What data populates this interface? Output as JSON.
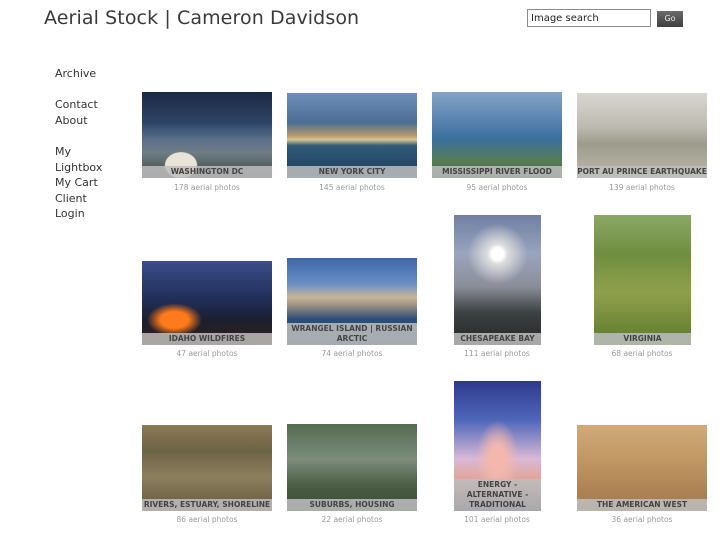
{
  "header": {
    "title": "Aerial Stock | Cameron Davidson",
    "search": {
      "value": "Image search",
      "button": "Go"
    }
  },
  "nav": [
    {
      "label": "Archive"
    },
    {
      "label": "Contact"
    },
    {
      "label": "About"
    },
    {
      "label": "My"
    },
    {
      "label": "Lightbox"
    },
    {
      "label": "My Cart"
    },
    {
      "label": "Client"
    },
    {
      "label": "Login"
    }
  ],
  "galleries": [
    {
      "title": "WASHINGTON DC",
      "count": "178 aerial photos"
    },
    {
      "title": "NEW YORK CITY",
      "count": "145 aerial photos"
    },
    {
      "title": "MISSISSIPPI RIVER FLOOD",
      "count": "95 aerial photos"
    },
    {
      "title": "PORT AU PRINCE EARTHQUAKE",
      "count": "139 aerial photos"
    },
    {
      "title": "IDAHO WILDFIRES",
      "count": "47 aerial photos"
    },
    {
      "title": "WRANGEL ISLAND | RUSSIAN ARCTIC",
      "count": "74 aerial photos"
    },
    {
      "title": "CHESAPEAKE BAY",
      "count": "111 aerial photos"
    },
    {
      "title": "VIRGINIA",
      "count": "68 aerial photos"
    },
    {
      "title": "RIVERS, ESTUARY, SHORELINE",
      "count": "86 aerial photos"
    },
    {
      "title": "SUBURBS, HOUSING",
      "count": "22 aerial photos"
    },
    {
      "title": "ENERGY - ALTERNATIVE - TRADITIONAL",
      "count": "101 aerial photos"
    },
    {
      "title": "THE AMERICAN WEST",
      "count": "36 aerial photos"
    }
  ]
}
